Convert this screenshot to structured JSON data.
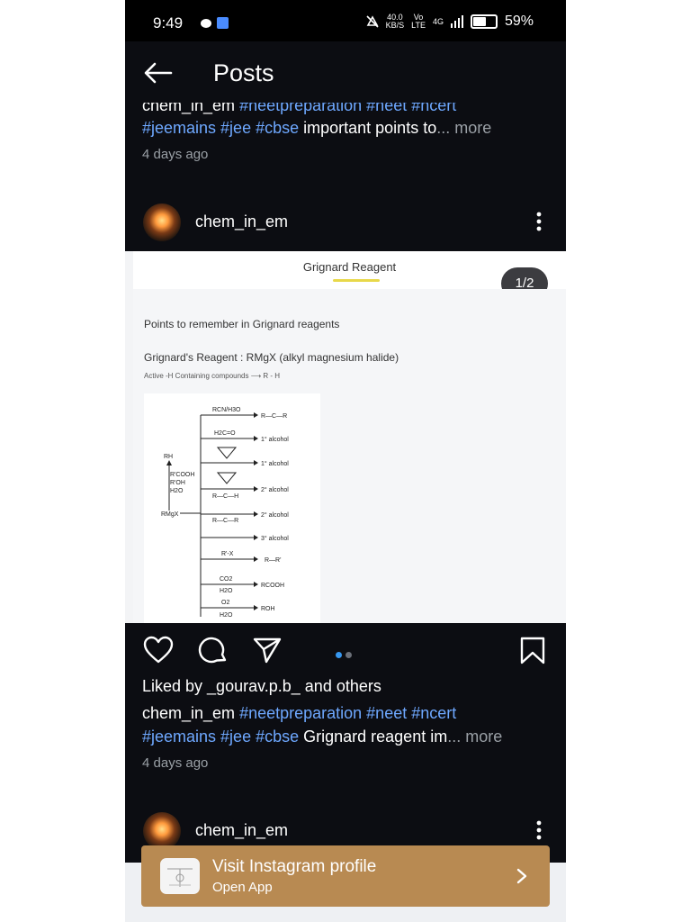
{
  "status_bar": {
    "time": "9:49",
    "net_speed_value": "40.0",
    "net_speed_unit": "KB/S",
    "net_label_top": "Vo",
    "net_label_bottom": "LTE",
    "signal_label": "4G",
    "battery": "59%"
  },
  "header": {
    "title": "Posts"
  },
  "prev_post": {
    "caption_line1_user": "chem_in_em",
    "caption_line1_tags": " #neetpreparation #neet #ncert",
    "caption_line2_tags": "#jeemains #jee #cbse",
    "caption_line2_text": "  important points to",
    "more": "... more",
    "time": "4 days ago"
  },
  "post": {
    "username": "chem_in_em",
    "slide_title": "Grignard Reagent",
    "page_indicator": "1/2",
    "slide_line1": "Points to remember in Grignard reagents",
    "slide_line2": "Grignard's Reagent : RMgX (alkyl magnesium halide)",
    "slide_line3": "Active -H Containing compounds ⟶ R - H",
    "diagram_labels": {
      "rh": "RH",
      "reagents": [
        "R'COOH",
        "R'OH",
        "H2O"
      ],
      "rmgx": "RMgX",
      "rcn": "RCN/H3O",
      "h2co": "H2C=O",
      "alcohol1a": "1° alcohol",
      "alcohol1b": "1° alcohol",
      "alcohol2a": "2° alcohol",
      "alcohol2b": "2° alcohol",
      "alcohol3": "3° alcohol",
      "rx": "R'-X",
      "rr": "R—R'",
      "co2": "CO2",
      "h2o_a": "H2O",
      "rcooh": "RCOOH",
      "o2": "O2",
      "h2o_b": "H2O",
      "roh": "ROH"
    },
    "carousel": {
      "current": 1,
      "total": 2
    },
    "liked_prefix": "Liked by ",
    "liked_user": "_gourav.p.b_",
    "liked_suffix": " and others",
    "caption_user": "chem_in_em",
    "caption_tags1": " #neetpreparation #neet #ncert",
    "caption_tags2": "#jeemains #jee #cbse",
    "caption_text": "  Grignard reagent im",
    "more": "... more",
    "time": "4 days ago"
  },
  "next_post": {
    "username": "chem_in_em"
  },
  "banner": {
    "title": "Visit Instagram profile",
    "subtitle": "Open App"
  },
  "colors": {
    "background": "#0c0d12",
    "hashtag": "#6ea8ff",
    "muted": "#9aa0a6",
    "banner": "#b88a52",
    "active_dot": "#3797f0"
  },
  "icons": [
    "back-arrow-icon",
    "kebab-menu-icon",
    "heart-icon",
    "comment-icon",
    "share-icon",
    "bookmark-icon",
    "chevron-right-icon"
  ]
}
